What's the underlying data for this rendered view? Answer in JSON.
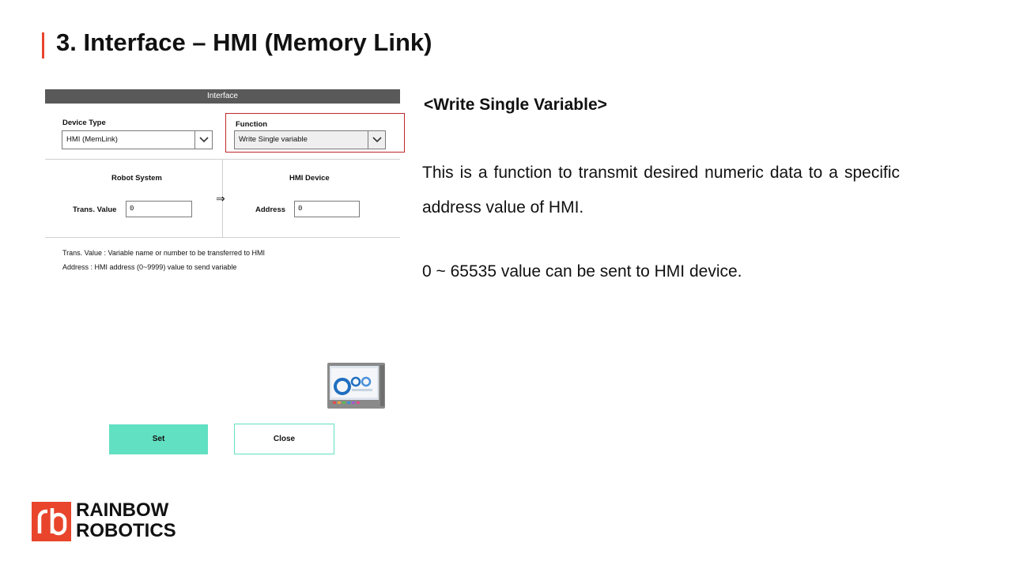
{
  "slide": {
    "title": "3. Interface – HMI (Memory Link)"
  },
  "panel": {
    "header": "Interface",
    "device_type_label": "Device Type",
    "device_type_value": "HMI (MemLink)",
    "function_label": "Function",
    "function_value": "Write Single variable",
    "robot_system_label": "Robot System",
    "hmi_device_label": "HMI Device",
    "arrow": "⇒",
    "trans_value_label": "Trans. Value",
    "trans_value": "0",
    "address_label": "Address",
    "address_value": "0",
    "note1": "Trans. Value : Variable name or number to be transferred to HMI",
    "note2": "Address : HMI address (0~9999) value to send variable",
    "set_label": "Set",
    "close_label": "Close"
  },
  "content": {
    "heading": "<Write Single Variable>",
    "paragraph1": "This is a function to transmit desired numeric data to a specific address value of HMI.",
    "paragraph2": "0 ~ 65535 value can be sent to HMI device."
  },
  "logo": {
    "line1": "RAINBOW",
    "line2": "ROBOTICS"
  },
  "colors": {
    "accent_red": "#e8452c",
    "button_teal": "#62e0c2",
    "header_gray": "#595959",
    "highlight_red": "#c0272d"
  },
  "icons": {
    "dropdown": "chevron-down-icon",
    "hmi_device_image": "hmi-touch-panel-image",
    "logo_mark": "rb-logo-mark"
  }
}
